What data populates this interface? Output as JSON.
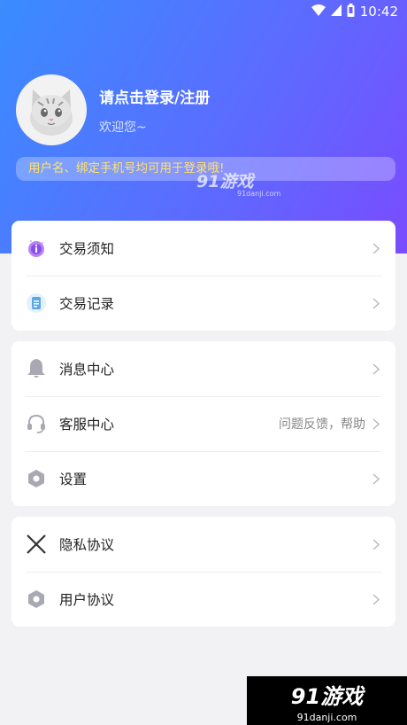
{
  "status_bar": {
    "time": "10:42",
    "icons": [
      "wifi-icon",
      "signal-icon",
      "battery-icon"
    ]
  },
  "profile": {
    "login_text": "请点击登录/注册",
    "welcome_text": "欢迎您~",
    "avatar": "cat-avatar"
  },
  "tip": {
    "text": "用户名、绑定手机号均可用于登录哦!"
  },
  "watermark": {
    "brand": "91游戏",
    "site": "91danji.com"
  },
  "cards": [
    {
      "items": [
        {
          "label": "交易须知",
          "icon": "purple-badge-icon"
        },
        {
          "label": "交易记录",
          "icon": "blue-document-icon"
        }
      ]
    },
    {
      "items": [
        {
          "label": "消息中心",
          "icon": "bell-icon"
        },
        {
          "label": "客服中心",
          "icon": "headset-icon",
          "extra": "问题反馈，帮助"
        },
        {
          "label": "设置",
          "icon": "hexagon-settings-icon"
        }
      ]
    },
    {
      "items": [
        {
          "label": "隐私协议",
          "icon": "close-x-icon"
        },
        {
          "label": "用户协议",
          "icon": "hexagon-settings-icon"
        }
      ]
    }
  ],
  "colors": {
    "gradient_start": "#3a8cff",
    "gradient_end": "#7a4cff",
    "tip_text": "#ffe36b"
  }
}
